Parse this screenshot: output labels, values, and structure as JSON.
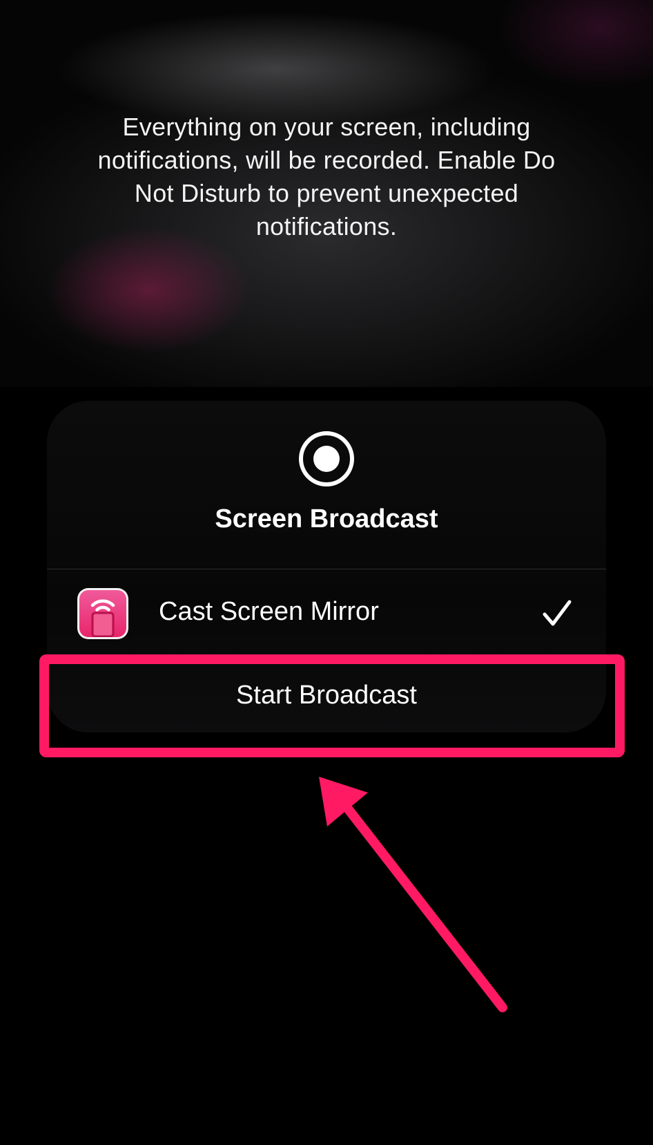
{
  "notice": {
    "line1": "Everything on your screen, including",
    "line2": "notifications, will be recorded. Enable Do",
    "line3": "Not Disturb to prevent unexpected",
    "line4": "notifications."
  },
  "sheet": {
    "icon": "record-icon",
    "title": "Screen Broadcast",
    "app": {
      "icon": "cast-screen-mirror-app-icon",
      "label": "Cast Screen Mirror",
      "selected": true,
      "selected_icon": "checkmark-icon"
    },
    "start_label": "Start Broadcast"
  },
  "annotation": {
    "color": "#ff1a63",
    "highlight_target": "start-broadcast-button",
    "arrow_icon": "pointer-arrow-icon"
  }
}
